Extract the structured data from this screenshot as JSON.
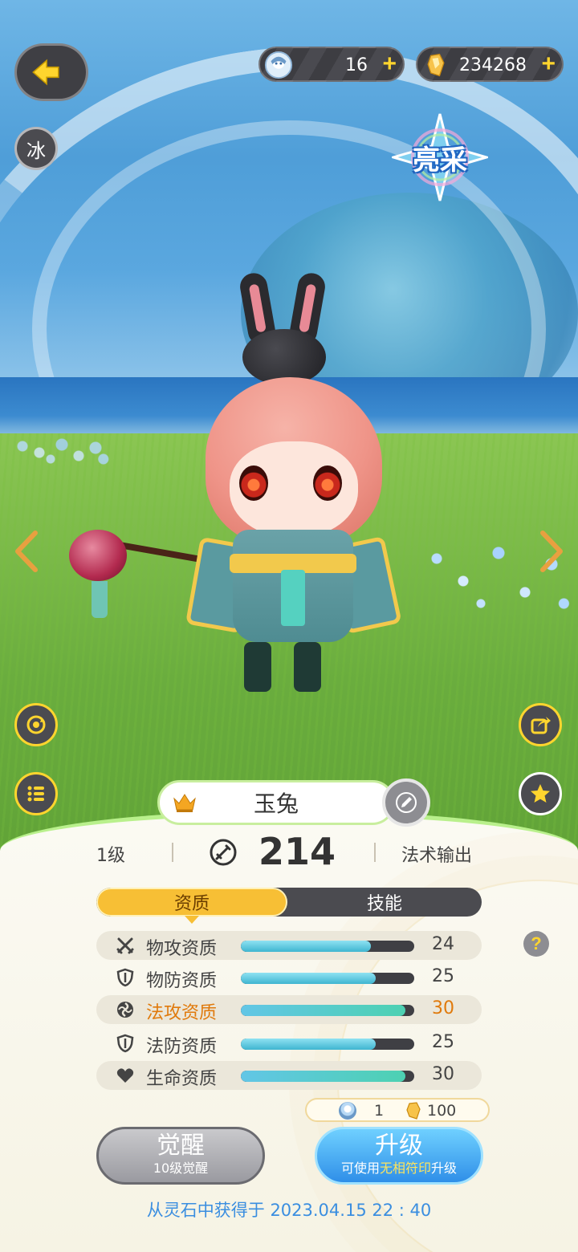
{
  "hud": {
    "gem_count": "16",
    "coin_count": "234268",
    "plus_symbol": "+",
    "element_badge": "冰",
    "shine_badge": "亮采"
  },
  "character": {
    "name": "玉兔",
    "level": "1级",
    "power": "214",
    "role": "法术输出"
  },
  "tabs": [
    {
      "label": "资质",
      "active": true
    },
    {
      "label": "技能",
      "active": false
    }
  ],
  "attributes": [
    {
      "icon": "swords-icon",
      "label": "物攻资质",
      "value": "24",
      "fraction": 0.75,
      "highlight": false
    },
    {
      "icon": "shield-icon",
      "label": "物防资质",
      "value": "25",
      "fraction": 0.78,
      "highlight": false
    },
    {
      "icon": "magic-swirl-icon",
      "label": "法攻资质",
      "value": "30",
      "fraction": 0.95,
      "highlight": true
    },
    {
      "icon": "shield-icon",
      "label": "法防资质",
      "value": "25",
      "fraction": 0.78,
      "highlight": false
    },
    {
      "icon": "heart-icon",
      "label": "生命资质",
      "value": "30",
      "fraction": 0.95,
      "highlight": true
    }
  ],
  "cost": {
    "gem": "1",
    "coin": "100"
  },
  "buttons": {
    "awaken_label": "觉醒",
    "awaken_sub": "10级觉醒",
    "upgrade_label": "升级",
    "upgrade_sub_prefix": "可使用",
    "upgrade_sub_highlight": "无相符印",
    "upgrade_sub_suffix": "升级"
  },
  "obtained_text": "从灵石中获得于 2023.04.15   22 : 40",
  "colors": {
    "accent_yellow": "#f7bf35",
    "highlight_orange": "#e07a0c",
    "upgrade_blue": "#2f8fe8"
  }
}
